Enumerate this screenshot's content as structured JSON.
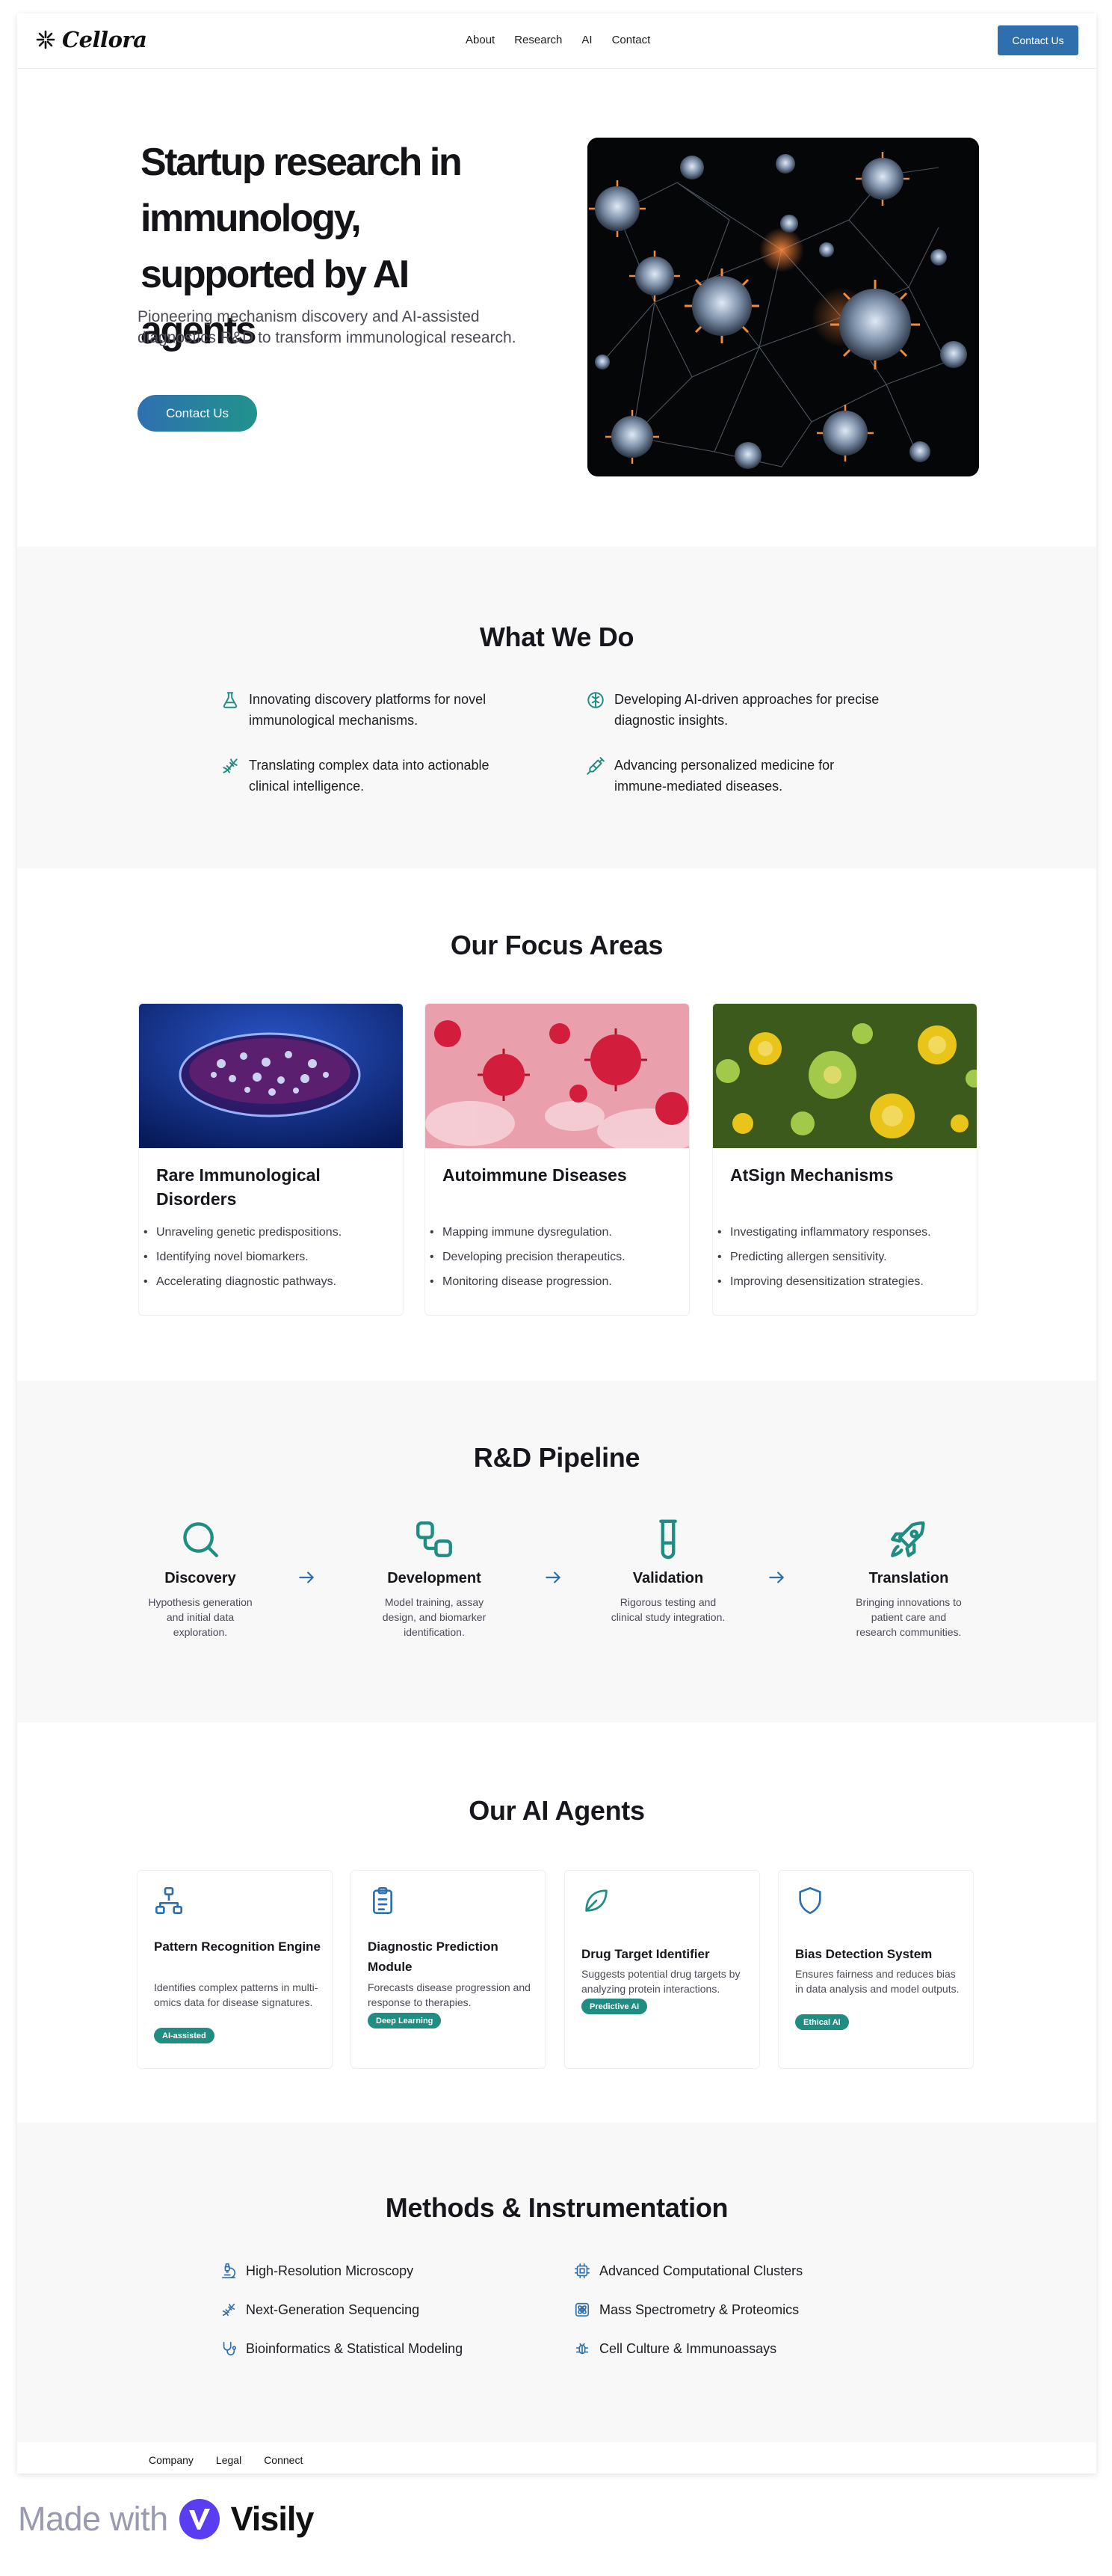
{
  "nav": {
    "logo_text": "Cellora",
    "links": [
      "About",
      "Research",
      "AI",
      "Contact"
    ],
    "cta": "Contact Us"
  },
  "hero": {
    "title_lines": [
      "Startup research in",
      "immunology,",
      "supported by AI agents"
    ],
    "subtitle": "Pioneering mechanism discovery and AI-assisted diagnostics R&D to transform immunological research.",
    "cta": "Contact Us"
  },
  "what_we_do": {
    "title": "What We Do",
    "items": [
      {
        "icon": "flask-icon",
        "text": "Innovating discovery platforms for novel immunological mechanisms."
      },
      {
        "icon": "brain-icon",
        "text": "Developing AI-driven approaches for precise diagnostic insights."
      },
      {
        "icon": "dna-icon",
        "text": "Translating complex data into actionable clinical intelligence."
      },
      {
        "icon": "syringe-icon",
        "text": "Advancing personalized medicine for immune-mediated diseases."
      }
    ]
  },
  "focus": {
    "title": "Our Focus Areas",
    "cards": [
      {
        "title": "Rare Immunological Disorders",
        "items": [
          "Unraveling genetic predispositions.",
          "Identifying novel biomarkers.",
          "Accelerating diagnostic pathways."
        ]
      },
      {
        "title": "Autoimmune Diseases",
        "items": [
          "Mapping immune dysregulation.",
          "Developing precision therapeutics.",
          "Monitoring disease progression."
        ]
      },
      {
        "title": "AtSign Mechanisms",
        "items": [
          "Investigating inflammatory responses.",
          "Predicting allergen sensitivity.",
          "Improving desensitization strategies."
        ]
      }
    ]
  },
  "pipeline": {
    "title": "R&D Pipeline",
    "steps": [
      {
        "icon": "search-icon",
        "name": "Discovery",
        "desc": "Hypothesis generation and initial data exploration."
      },
      {
        "icon": "workflow-icon",
        "name": "Development",
        "desc": "Model training, assay design, and biomarker identification."
      },
      {
        "icon": "test-tube-icon",
        "name": "Validation",
        "desc": "Rigorous testing and clinical study integration."
      },
      {
        "icon": "rocket-icon",
        "name": "Translation",
        "desc": "Bringing innovations to patient care and research communities."
      }
    ]
  },
  "agents": {
    "title": "Our AI Agents",
    "cards": [
      {
        "icon": "network-icon",
        "title": "Pattern Recognition Engine",
        "desc": "Identifies complex patterns in multi-omics data for disease signatures.",
        "badge": "AI-assisted"
      },
      {
        "icon": "clipboard-icon",
        "title": "Diagnostic Prediction Module",
        "desc": "Forecasts disease progression and response to therapies.",
        "badge": "Deep Learning"
      },
      {
        "icon": "leaf-icon",
        "title": "Drug Target Identifier",
        "desc": "Suggests potential drug targets by analyzing protein interactions.",
        "badge": "Predictive AI"
      },
      {
        "icon": "shield-icon",
        "title": "Bias Detection System",
        "desc": "Ensures fairness and reduces bias in data analysis and model outputs.",
        "badge": "Ethical AI"
      }
    ]
  },
  "methods": {
    "title": "Methods & Instrumentation",
    "items": [
      {
        "icon": "microscope-icon",
        "text": "High-Resolution Microscopy"
      },
      {
        "icon": "cpu-icon",
        "text": "Advanced Computational Clusters"
      },
      {
        "icon": "dna-icon",
        "text": "Next-Generation Sequencing"
      },
      {
        "icon": "atom-icon",
        "text": "Mass Spectrometry & Proteomics"
      },
      {
        "icon": "stethoscope-icon",
        "text": "Bioinformatics & Statistical Modeling"
      },
      {
        "icon": "bug-icon",
        "text": "Cell Culture & Immunoassays"
      }
    ]
  },
  "footer": {
    "links": [
      "Company",
      "Legal",
      "Connect"
    ]
  },
  "branding": {
    "made_with": "Made with",
    "visily": "Visily"
  },
  "colors": {
    "primary_blue": "#2f6fad",
    "teal": "#1f8d82",
    "section_gray": "#f8f8f8"
  }
}
